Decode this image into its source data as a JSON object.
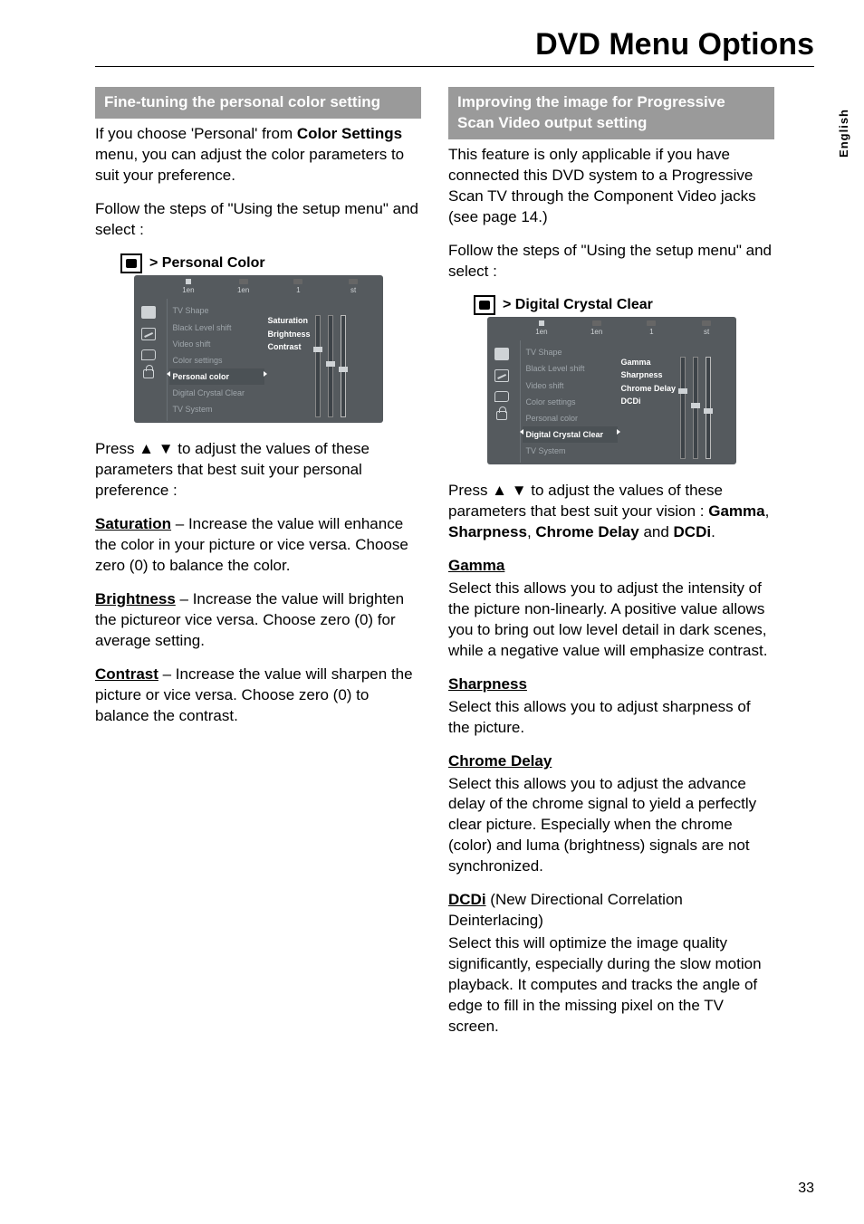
{
  "page_title": "DVD Menu Options",
  "language_tab": "English",
  "page_number": "33",
  "left": {
    "section_header": "Fine-tuning the personal color setting",
    "para1_pre": "If you choose 'Personal' from ",
    "para1_bold": "Color Settings",
    "para1_post": " menu, you can adjust the color parameters to suit your preference.",
    "para2": "Follow the steps of \"Using the setup menu\" and select :",
    "menu_title": ">  Personal Color",
    "osd_tabs": [
      "1en",
      "1en",
      "1",
      "st"
    ],
    "osd_items": [
      "TV Shape",
      "Black Level shift",
      "Video shift",
      "Color settings",
      "Personal color",
      "Digital Crystal Clear",
      "TV System"
    ],
    "osd_active_index": 4,
    "osd_sub": [
      "Saturation",
      "Brightness",
      "Contrast"
    ],
    "para3": "Press ▲ ▼ to adjust the values of these parameters that best suit your personal preference :",
    "sat_label": "Saturation",
    "sat_text": " – Increase the value will enhance the color in your picture or vice versa. Choose zero (0) to balance the color.",
    "bri_label": "Brightness",
    "bri_text": " – Increase the value will brighten the pictureor vice versa. Choose zero (0) for average setting.",
    "con_label": "Contrast",
    "con_text": " – Increase the value will sharpen the picture or vice versa. Choose zero (0) to balance the contrast."
  },
  "right": {
    "section_header": "Improving the image for Progressive Scan Video output setting",
    "para1": "This feature is only applicable if you have connected this DVD system to a Progressive Scan TV through the Component Video jacks (see page 14.)",
    "para2": "Follow the steps of \"Using the setup menu\" and select :",
    "menu_title": ">  Digital Crystal Clear",
    "osd_tabs": [
      "1en",
      "1en",
      "1",
      "st"
    ],
    "osd_items": [
      "TV Shape",
      "Black Level shift",
      "Video shift",
      "Color settings",
      "Personal color",
      "Digital Crystal Clear",
      "TV System"
    ],
    "osd_active_index": 5,
    "osd_sub": [
      "Gamma",
      "Sharpness",
      "Chrome Delay",
      "DCDi"
    ],
    "para3_pre": "Press ▲ ▼ to adjust the values of these parameters that best suit your vision : ",
    "para3_b1": "Gamma",
    "para3_s1": ", ",
    "para3_b2": "Sharpness",
    "para3_s2": ", ",
    "para3_b3": "Chrome Delay",
    "para3_s3": " and ",
    "para3_b4": "DCDi",
    "para3_post": ".",
    "gamma_label": "Gamma",
    "gamma_text": "Select this allows you to adjust the intensity of the picture non-linearly. A positive value allows you to bring out low level detail in dark scenes, while a negative value will emphasize contrast.",
    "sharp_label": "Sharpness",
    "sharp_text": "Select this allows you to adjust sharpness of the picture.",
    "chrome_label": "Chrome Delay",
    "chrome_text": "Select this allows you to adjust the advance delay of the chrome signal to yield a perfectly clear picture.  Especially when the chrome (color) and luma (brightness) signals are not synchronized.",
    "dcdi_label": "DCDi",
    "dcdi_paren": " (New Directional Correlation Deinterlacing)",
    "dcdi_text": "Select this will optimize the image quality significantly, especially during the slow motion playback.  It computes and tracks the angle of edge to fill in the missing pixel on the TV screen."
  }
}
